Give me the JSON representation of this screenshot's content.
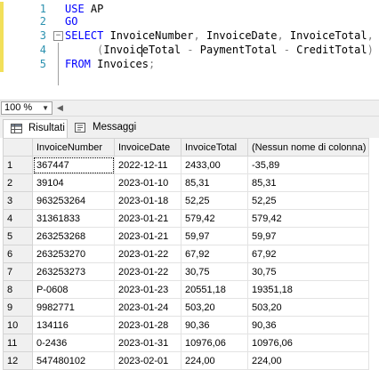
{
  "editor": {
    "lines": [
      {
        "num": "1",
        "tokens": [
          {
            "t": "USE",
            "c": "kw"
          },
          {
            "t": " AP",
            "c": ""
          }
        ]
      },
      {
        "num": "2",
        "tokens": [
          {
            "t": "GO",
            "c": "kw"
          }
        ]
      },
      {
        "num": "3",
        "tokens": [
          {
            "t": "SELECT",
            "c": "kw"
          },
          {
            "t": " InvoiceNumber",
            "c": ""
          },
          {
            "t": ",",
            "c": "op"
          },
          {
            "t": " InvoiceDate",
            "c": ""
          },
          {
            "t": ",",
            "c": "op"
          },
          {
            "t": " InvoiceTotal",
            "c": ""
          },
          {
            "t": ",",
            "c": "op"
          }
        ]
      },
      {
        "num": "4",
        "tokens": [
          {
            "t": "     ",
            "c": ""
          },
          {
            "t": "(",
            "c": "op"
          },
          {
            "t": "InvoiceTotal ",
            "c": ""
          },
          {
            "t": "-",
            "c": "op"
          },
          {
            "t": " PaymentTotal ",
            "c": ""
          },
          {
            "t": "-",
            "c": "op"
          },
          {
            "t": " CreditTotal",
            "c": ""
          },
          {
            "t": ")",
            "c": "op"
          }
        ]
      },
      {
        "num": "5",
        "tokens": [
          {
            "t": "FROM",
            "c": "kw"
          },
          {
            "t": " Invoices",
            "c": ""
          },
          {
            "t": ";",
            "c": "op"
          }
        ]
      }
    ]
  },
  "zoom": {
    "value": "100 %"
  },
  "tabs": [
    {
      "label": "Risultati",
      "icon": "grid-icon",
      "active": true
    },
    {
      "label": "Messaggi",
      "icon": "messages-icon",
      "active": false
    }
  ],
  "grid": {
    "columns": [
      "InvoiceNumber",
      "InvoiceDate",
      "InvoiceTotal",
      "(Nessun nome di colonna)"
    ],
    "rows": [
      [
        "1",
        "367447",
        "2022-12-11",
        "2433,00",
        "-35,89"
      ],
      [
        "2",
        "39104",
        "2023-01-10",
        "85,31",
        "85,31"
      ],
      [
        "3",
        "963253264",
        "2023-01-18",
        "52,25",
        "52,25"
      ],
      [
        "4",
        "31361833",
        "2023-01-21",
        "579,42",
        "579,42"
      ],
      [
        "5",
        "263253268",
        "2023-01-21",
        "59,97",
        "59,97"
      ],
      [
        "6",
        "263253270",
        "2023-01-22",
        "67,92",
        "67,92"
      ],
      [
        "7",
        "263253273",
        "2023-01-22",
        "30,75",
        "30,75"
      ],
      [
        "8",
        "P-0608",
        "2023-01-23",
        "20551,18",
        "19351,18"
      ],
      [
        "9",
        "9982771",
        "2023-01-24",
        "503,20",
        "503,20"
      ],
      [
        "10",
        "134116",
        "2023-01-28",
        "90,36",
        "90,36"
      ],
      [
        "11",
        "0-2436",
        "2023-01-31",
        "10976,06",
        "10976,06"
      ],
      [
        "12",
        "547480102",
        "2023-02-01",
        "224,00",
        "224,00"
      ]
    ]
  }
}
